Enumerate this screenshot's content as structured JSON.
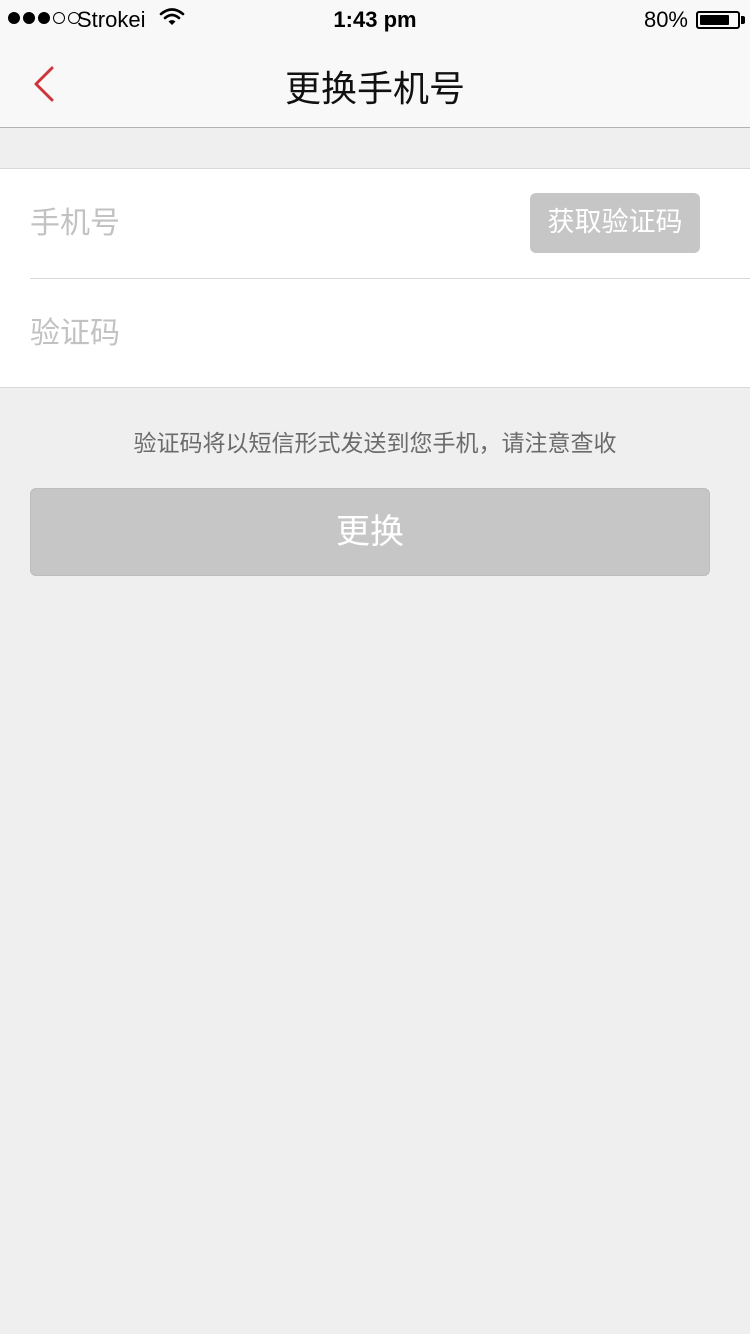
{
  "status_bar": {
    "carrier": "Strokei",
    "time": "1:43 pm",
    "battery": "80%",
    "battery_level": 0.8,
    "signal_filled": 3,
    "signal_total": 5
  },
  "nav": {
    "title": "更换手机号",
    "back_icon": "chevron-left-icon",
    "accent_color": "#d0343a"
  },
  "form": {
    "phone_placeholder": "手机号",
    "phone_value": "",
    "get_code_label": "获取验证码",
    "code_placeholder": "验证码",
    "code_value": ""
  },
  "hint": "验证码将以短信形式发送到您手机，请注意查收",
  "submit_label": "更换",
  "colors": {
    "background": "#efefef",
    "button_disabled": "#c6c6c6",
    "placeholder": "#c2c2c2"
  }
}
